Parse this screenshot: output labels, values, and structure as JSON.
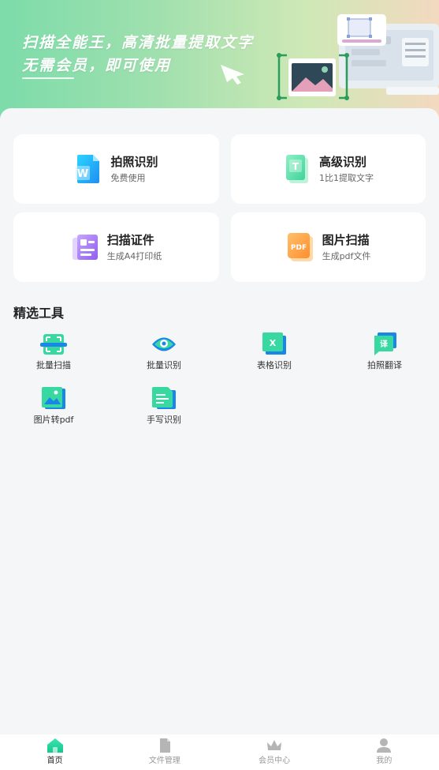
{
  "banner": {
    "line1": "扫描全能王，高清批量提取文字",
    "line2": "无需会员，即可使用"
  },
  "cards": [
    {
      "title": "拍照识别",
      "subtitle": "免费使用",
      "icon": "word-doc-icon"
    },
    {
      "title": "高级识别",
      "subtitle": "1比1提取文字",
      "icon": "text-doc-icon"
    },
    {
      "title": "扫描证件",
      "subtitle": "生成A4打印纸",
      "icon": "id-card-icon"
    },
    {
      "title": "图片扫描",
      "subtitle": "生成pdf文件",
      "icon": "pdf-icon"
    }
  ],
  "section": {
    "title": "精选工具"
  },
  "tools": [
    {
      "label": "批量扫描",
      "icon": "batch-scan-icon"
    },
    {
      "label": "批量识别",
      "icon": "batch-recognize-icon"
    },
    {
      "label": "表格识别",
      "icon": "excel-icon"
    },
    {
      "label": "拍照翻译",
      "icon": "translate-icon"
    },
    {
      "label": "图片转pdf",
      "icon": "image-to-pdf-icon"
    },
    {
      "label": "手写识别",
      "icon": "handwriting-icon"
    }
  ],
  "nav": [
    {
      "label": "首页",
      "icon": "home-icon",
      "active": true
    },
    {
      "label": "文件管理",
      "icon": "file-icon",
      "active": false
    },
    {
      "label": "会员中心",
      "icon": "crown-icon",
      "active": false
    },
    {
      "label": "我的",
      "icon": "user-icon",
      "active": false
    }
  ],
  "colors": {
    "accent": "#1ed6a0",
    "nav_inactive": "#b5b5b5",
    "background": "#f5f6f8"
  }
}
